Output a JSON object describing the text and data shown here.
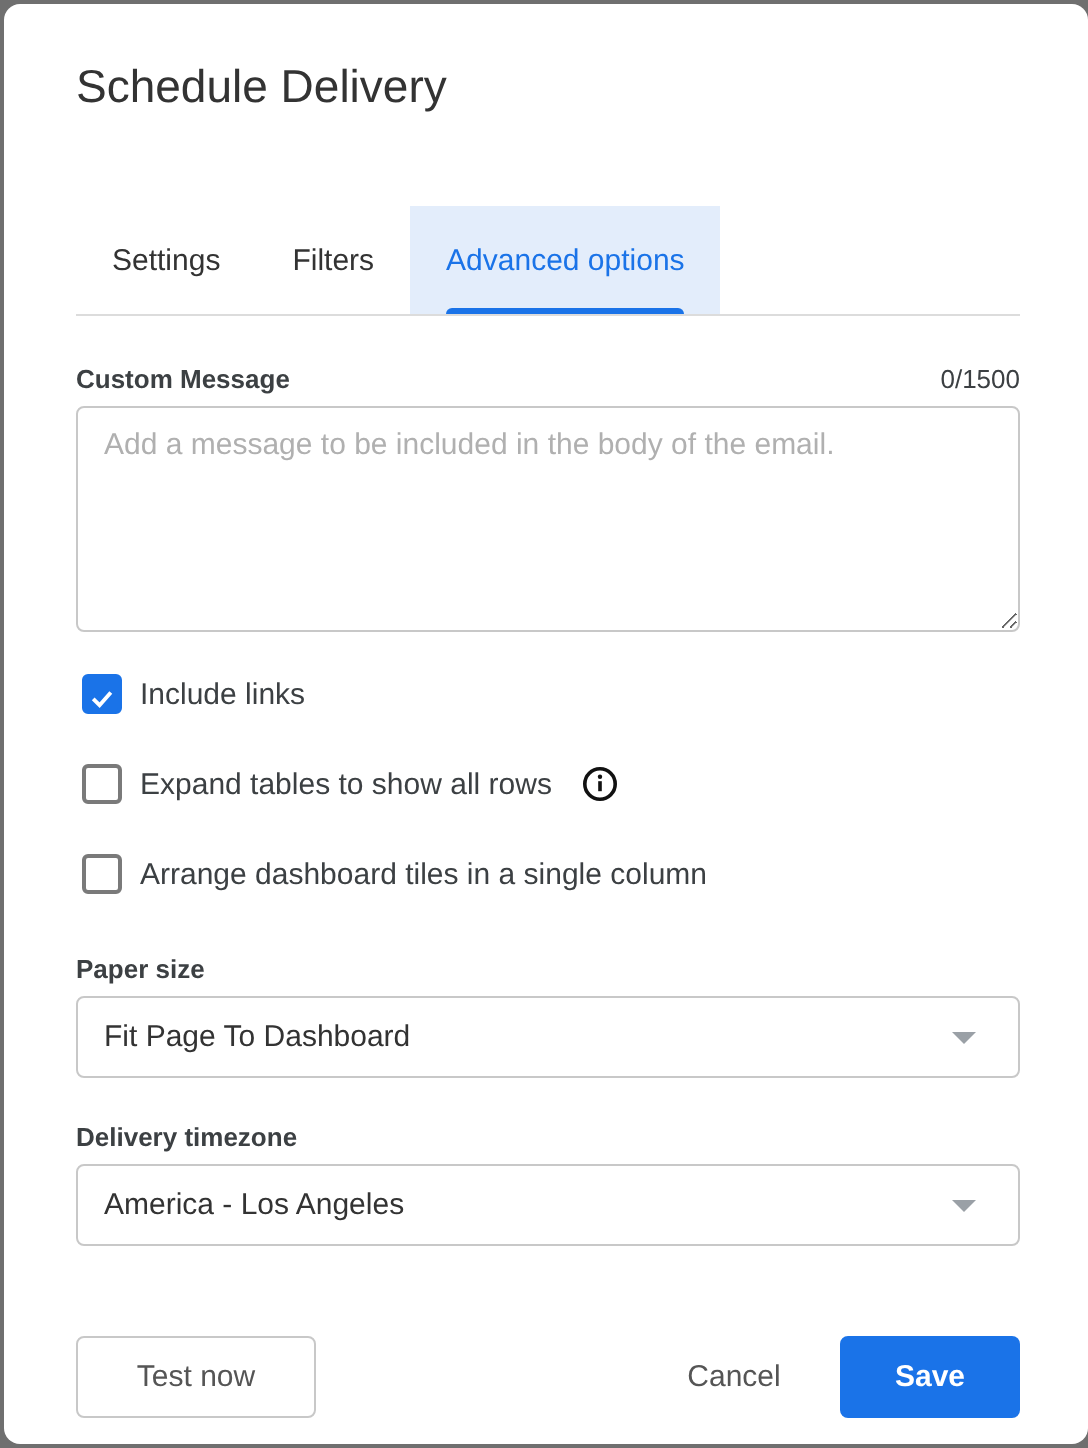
{
  "dialog": {
    "title": "Schedule Delivery"
  },
  "tabs": [
    {
      "label": "Settings",
      "selected": false
    },
    {
      "label": "Filters",
      "selected": false
    },
    {
      "label": "Advanced options",
      "selected": true
    }
  ],
  "custom_message": {
    "label": "Custom Message",
    "counter": "0/1500",
    "placeholder": "Add a message to be included in the body of the email."
  },
  "options": [
    {
      "label": "Include links",
      "checked": true,
      "has_info": false
    },
    {
      "label": "Expand tables to show all rows",
      "checked": false,
      "has_info": true
    },
    {
      "label": "Arrange dashboard tiles in a single column",
      "checked": false,
      "has_info": false
    }
  ],
  "selects": [
    {
      "label": "Paper size",
      "value": "Fit Page To Dashboard"
    },
    {
      "label": "Delivery timezone",
      "value": "America - Los Angeles"
    }
  ],
  "buttons": [
    {
      "label": "Test now",
      "kind": "outline"
    },
    {
      "label": "Cancel",
      "kind": "text"
    },
    {
      "label": "Save",
      "kind": "primary"
    }
  ]
}
